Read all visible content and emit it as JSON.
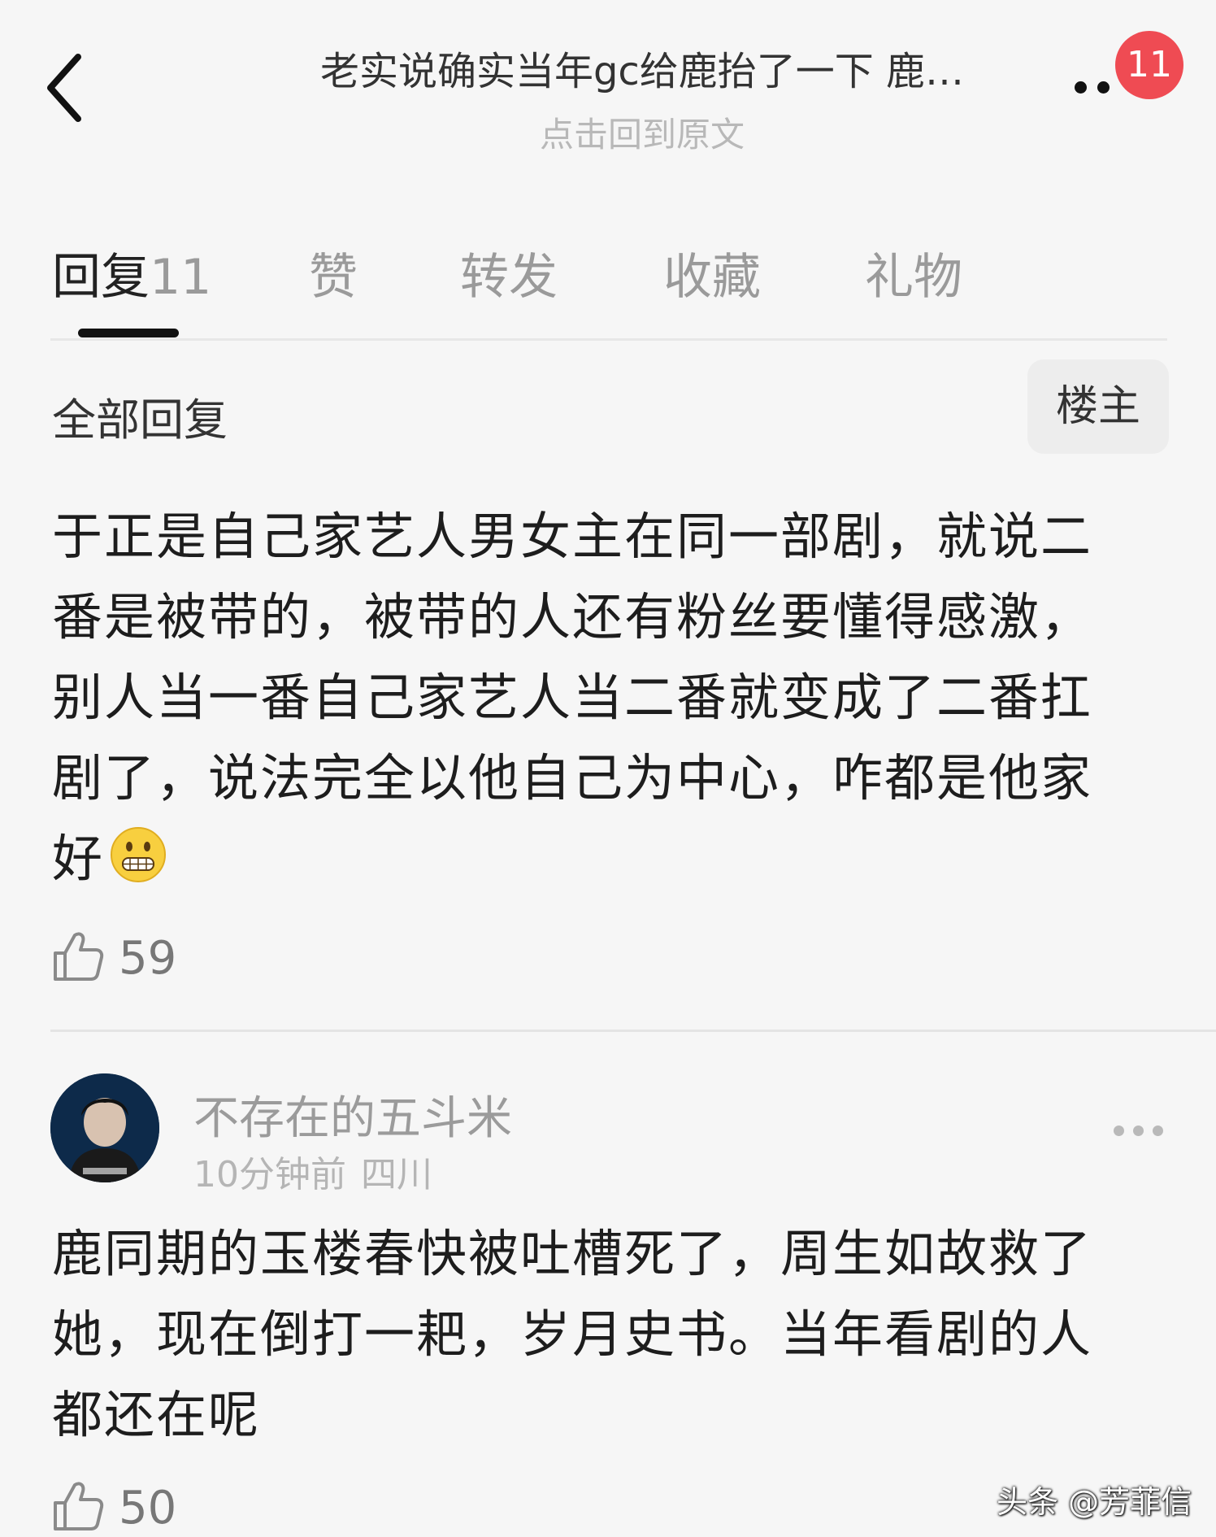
{
  "header": {
    "title": "老实说确实当年gc给鹿抬了一下 鹿…",
    "subtitle": "点击回到原文",
    "badge_count": "11",
    "back_icon": "chevron-left-icon",
    "more_icon": "more-dots-icon"
  },
  "tabs": [
    {
      "label": "回复",
      "count": "11",
      "active": true
    },
    {
      "label": "赞",
      "count": "",
      "active": false
    },
    {
      "label": "转发",
      "count": "",
      "active": false
    },
    {
      "label": "收藏",
      "count": "",
      "active": false
    },
    {
      "label": "礼物",
      "count": "",
      "active": false
    }
  ],
  "filter": {
    "label": "全部回复",
    "owner_button": "楼主"
  },
  "comments": [
    {
      "text": "于正是自己家艺人男女主在同一部剧，就说二番是被带的，被带的人还有粉丝要懂得感激，别人当一番自己家艺人当二番就变成了二番扛剧了，说法完全以他自己为中心，咋都是他家好",
      "emoji": "grimacing-face-icon",
      "likes": "59"
    },
    {
      "username": "不存在的五斗米",
      "time": "10分钟前",
      "location": "四川",
      "text": "鹿同期的玉楼春快被吐槽死了，周生如故救了她，现在倒打一耙，岁月史书。当年看剧的人都还在呢",
      "likes": "50"
    }
  ],
  "watermark": "头条 @芳菲信",
  "colors": {
    "badge": "#ef4b53",
    "background": "#f6f6f6",
    "text": "#1d1d1d",
    "muted": "#9b9b9b"
  }
}
